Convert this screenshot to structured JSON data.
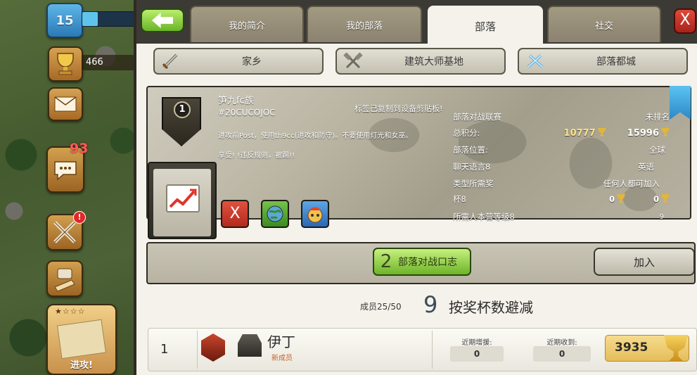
{
  "hud": {
    "level": "15",
    "trophies": "466",
    "chat_badge": "93",
    "alert_badge": "!",
    "attack_stars": "★☆☆☆",
    "attack_label": "进攻!"
  },
  "tabs": [
    {
      "label": "我的简介"
    },
    {
      "label": "我的部落"
    },
    {
      "label": "部落",
      "active": true
    },
    {
      "label": "社交"
    }
  ],
  "close_label": "X",
  "subnav": [
    {
      "label": "家乡",
      "icon": "sword-icon"
    },
    {
      "label": "建筑大师基地",
      "icon": "crossed-hammers-icon"
    },
    {
      "label": "部落都城",
      "icon": "crossed-swords-icon"
    }
  ],
  "clan": {
    "level": "1",
    "name": "笋九fc族",
    "tag": "#20CUCOJOC",
    "desc_line1": "进攻前Post，使用th9cc(进攻和防守)。不要使用灯光和女巫。",
    "desc_line2": "享受! !违反规则，被踢!!",
    "toast": "标签已复制到设备剪贴板!",
    "info": {
      "war_league_label": "部落对战联赛",
      "war_league_value": "未排名",
      "points_label": "总积分:",
      "points_gold": "10777",
      "points_white": "15996",
      "location_label": "部落位置:",
      "location_value": "全球",
      "language_label": "聊天语言8",
      "language_value": "英语",
      "type_label": "类型所需奖",
      "type_value": "任何人都可加入",
      "cups_label": "杯8",
      "cups_a": "0",
      "cups_b": "0",
      "th_label": "所需人本营等级8",
      "th_value": "9"
    },
    "icon_x_label": "X"
  },
  "warlog": {
    "number": "2",
    "label": "部落对战口志"
  },
  "join_label": "加入",
  "members_header": {
    "count": "成员25/50",
    "sort_number": "9",
    "sort_label": "按奖杯数避减"
  },
  "members": [
    {
      "rank": "1",
      "name": "伊丁",
      "role": "新成员",
      "donated_label": "近期增援:",
      "donated": "0",
      "received_label": "近期收到:",
      "received": "0",
      "trophies": "3935"
    }
  ],
  "colors": {
    "accent_green": "#6eb42a",
    "close_red": "#c0342a",
    "gold": "#e5bd5b"
  }
}
